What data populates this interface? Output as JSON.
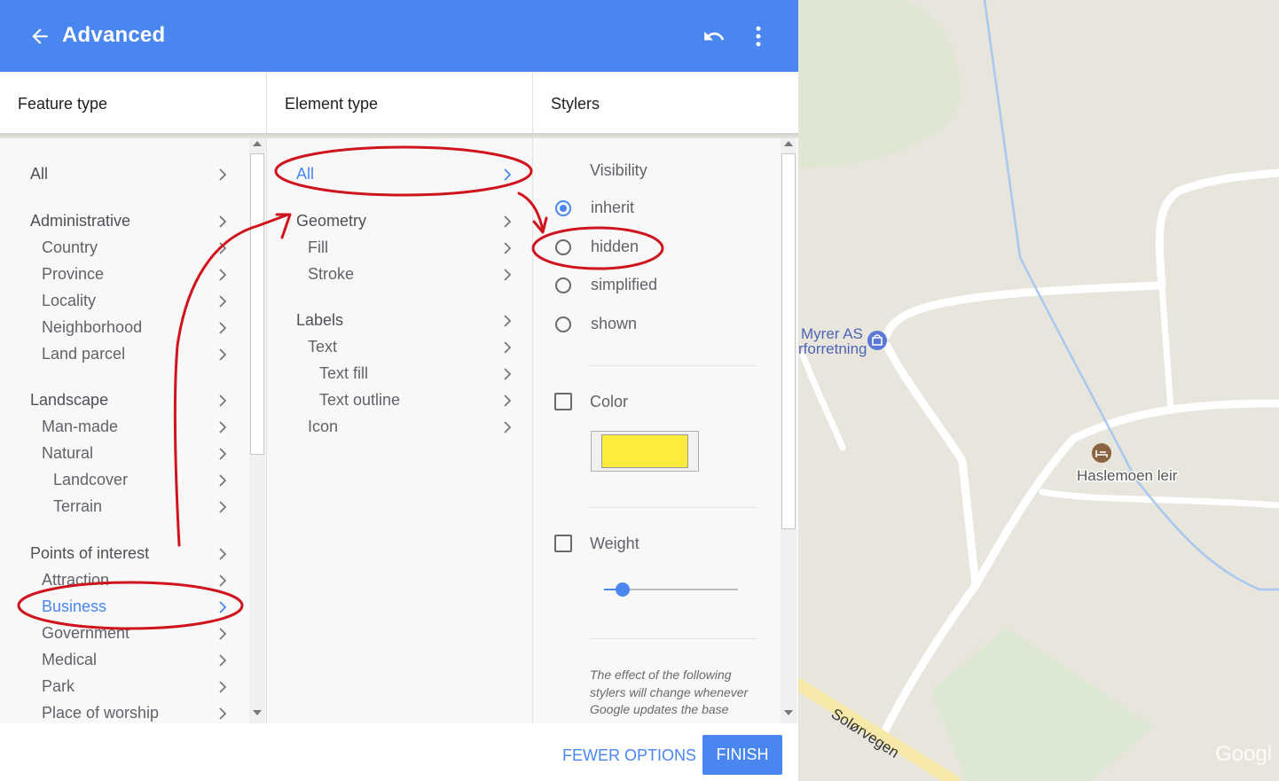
{
  "header": {
    "title": "Advanced",
    "bg": "#4a86f0"
  },
  "columns": {
    "feature_type": "Feature type",
    "element_type": "Element type",
    "stylers": "Stylers"
  },
  "feature_items": [
    {
      "label": "All",
      "level": 0
    },
    {
      "label": "Administrative",
      "level": 0
    },
    {
      "label": "Country",
      "level": 1
    },
    {
      "label": "Province",
      "level": 1
    },
    {
      "label": "Locality",
      "level": 1
    },
    {
      "label": "Neighborhood",
      "level": 1
    },
    {
      "label": "Land parcel",
      "level": 1
    },
    {
      "label": "Landscape",
      "level": 0
    },
    {
      "label": "Man-made",
      "level": 1
    },
    {
      "label": "Natural",
      "level": 1
    },
    {
      "label": "Landcover",
      "level": 2
    },
    {
      "label": "Terrain",
      "level": 2
    },
    {
      "label": "Points of interest",
      "level": 0
    },
    {
      "label": "Attraction",
      "level": 1
    },
    {
      "label": "Business",
      "level": 1,
      "selected": true
    },
    {
      "label": "Government",
      "level": 1
    },
    {
      "label": "Medical",
      "level": 1
    },
    {
      "label": "Park",
      "level": 1
    },
    {
      "label": "Place of worship",
      "level": 1
    }
  ],
  "element_items": [
    {
      "label": "All",
      "level": 0,
      "selected": true
    },
    {
      "label": "Geometry",
      "level": 0
    },
    {
      "label": "Fill",
      "level": 1
    },
    {
      "label": "Stroke",
      "level": 1
    },
    {
      "label": "Labels",
      "level": 0
    },
    {
      "label": "Text",
      "level": 1
    },
    {
      "label": "Text fill",
      "level": 2
    },
    {
      "label": "Text outline",
      "level": 2
    },
    {
      "label": "Icon",
      "level": 1
    }
  ],
  "stylers": {
    "visibility_label": "Visibility",
    "options": [
      {
        "label": "inherit",
        "checked": true
      },
      {
        "label": "hidden",
        "checked": false
      },
      {
        "label": "simplified",
        "checked": false
      },
      {
        "label": "shown",
        "checked": false
      }
    ],
    "color_label": "Color",
    "color_value": "#ffeb3b",
    "weight_label": "Weight",
    "weight_fraction": 0.14,
    "note": "The effect of the following stylers will change whenever Google updates the base"
  },
  "footer": {
    "fewer_options": "FEWER OPTIONS",
    "finish": "FINISH"
  },
  "map": {
    "labels": [
      "Myrer AS",
      "rforretning",
      "Haslemoen leir",
      "Solørvegen",
      "Googl"
    ]
  },
  "accent": "#4a86f0",
  "annotation_color": "#d0141e"
}
